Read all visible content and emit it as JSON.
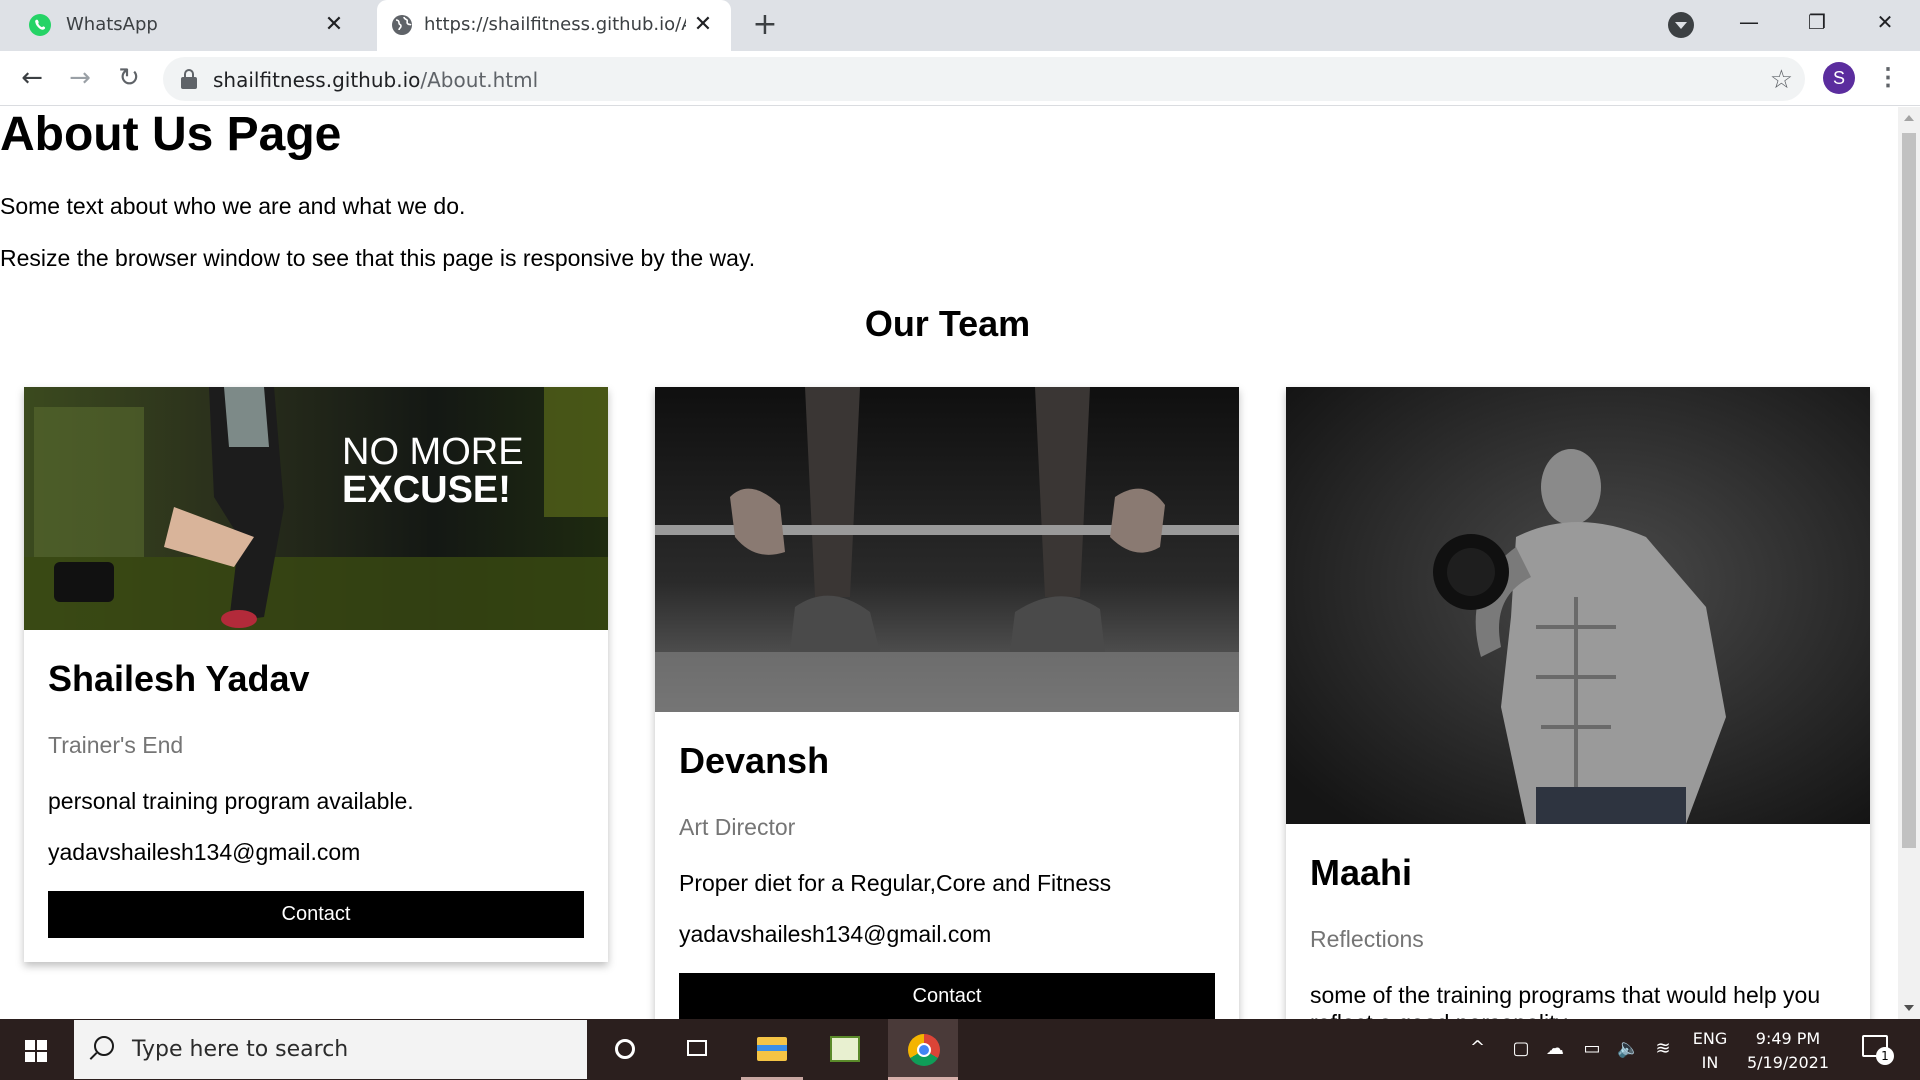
{
  "browser": {
    "tabs": [
      {
        "title": "WhatsApp",
        "icon": "whatsapp-icon",
        "active": false
      },
      {
        "title": "https://shailfitness.github.io/About.html",
        "icon": "globe-icon",
        "active": true
      }
    ],
    "close_glyph": "✕",
    "new_tab_glyph": "+",
    "window_controls": {
      "minimize": "—",
      "maximize": "❐",
      "close": "✕"
    },
    "nav": {
      "back": "←",
      "forward": "→",
      "reload": "↻"
    },
    "address": {
      "domain": "shailfitness.github.io",
      "path": "/About.html"
    },
    "star_glyph": "☆",
    "profile_initial": "S",
    "menu_glyph": "⋮"
  },
  "page": {
    "title": "About Us Page",
    "paragraphs": [
      "Some text about who we are and what we do.",
      "Resize the browser window to see that this page is responsive by the way."
    ],
    "team_heading": "Our Team",
    "members": [
      {
        "name": "Shailesh Yadav",
        "role": "Trainer's End",
        "description": "personal training program available.",
        "email": "yadavshailesh134@gmail.com",
        "button": "Contact",
        "photo_text": [
          "NO MORE",
          "EXCUSE!"
        ]
      },
      {
        "name": "Devansh",
        "role": "Art Director",
        "description": "Proper diet for a Regular,Core and Fitness",
        "email": "yadavshailesh134@gmail.com",
        "button": "Contact"
      },
      {
        "name": "Maahi",
        "role": "Reflections",
        "description": "some of the training programs that would help you reflect a good personality"
      }
    ]
  },
  "taskbar": {
    "search_placeholder": "Type here to search",
    "tray": {
      "chevron": "^",
      "language_top": "ENG",
      "language_bottom": "IN",
      "time": "9:49 PM",
      "date": "5/19/2021",
      "notification_count": "1"
    }
  },
  "colors": {
    "tabstrip": "#dee1e6",
    "taskbar": "#2b1f1e",
    "button_bg": "#000000",
    "role_text": "#757575",
    "avatar": "#5b2d9e"
  }
}
